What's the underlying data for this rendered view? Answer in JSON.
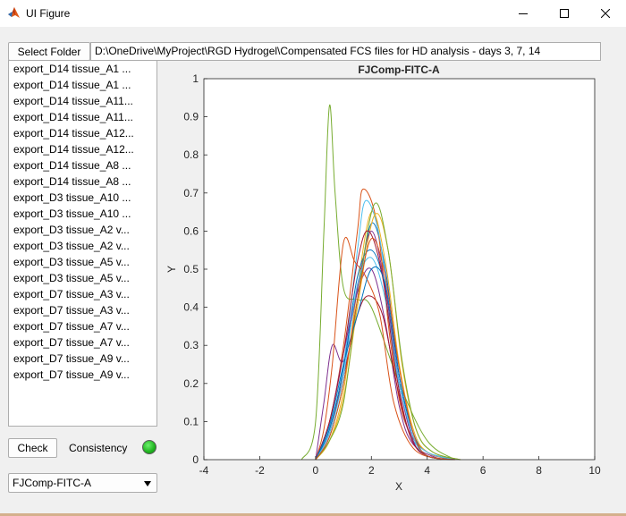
{
  "window": {
    "title": "UI Figure"
  },
  "toolbar": {
    "select_folder_label": "Select Folder",
    "folder_path": "D:\\OneDrive\\MyProject\\RGD Hydrogel\\Compensated FCS files for HD analysis - days 3, 7, 14"
  },
  "files": [
    "export_D14 tissue_A1 ...",
    "export_D14 tissue_A1 ...",
    "export_D14 tissue_A11...",
    "export_D14 tissue_A11...",
    "export_D14 tissue_A12...",
    "export_D14 tissue_A12...",
    "export_D14 tissue_A8 ...",
    "export_D14 tissue_A8 ...",
    "export_D3 tissue_A10 ...",
    "export_D3 tissue_A10 ...",
    "export_D3 tissue_A2 v...",
    "export_D3 tissue_A2 v...",
    "export_D3 tissue_A5 v...",
    "export_D3 tissue_A5 v...",
    "export_D7 tissue_A3 v...",
    "export_D7 tissue_A3 v...",
    "export_D7 tissue_A7 v...",
    "export_D7 tissue_A7 v...",
    "export_D7 tissue_A9 v...",
    "export_D7 tissue_A9 v..."
  ],
  "controls": {
    "check_label": "Check",
    "consistency_label": "Consistency",
    "status_color": "#22bb22",
    "channel_selected": "FJComp-FITC-A"
  },
  "chart_data": {
    "type": "line",
    "title": "FJComp-FITC-A",
    "xlabel": "X",
    "ylabel": "Y",
    "xlim": [
      -4,
      10
    ],
    "ylim": [
      0,
      1
    ],
    "xticks": [
      -4,
      -2,
      0,
      2,
      4,
      6,
      8,
      10
    ],
    "yticks": [
      0,
      0.1,
      0.2,
      0.3,
      0.4,
      0.5,
      0.6,
      0.7,
      0.8,
      0.9,
      1
    ],
    "ytick_labels": [
      "0",
      "0.1",
      "0.2",
      "0.3",
      "0.4",
      "0.5",
      "0.6",
      "0.7",
      "0.8",
      "0.9",
      "1"
    ],
    "grid": false,
    "series": [
      {
        "color": "#0072BD",
        "x": [
          0,
          0.5,
          1.0,
          1.5,
          2.0,
          2.5,
          3.0,
          3.5,
          4.0,
          5.0
        ],
        "y": [
          0,
          0.06,
          0.2,
          0.42,
          0.62,
          0.5,
          0.22,
          0.07,
          0.02,
          0
        ]
      },
      {
        "color": "#D95319",
        "x": [
          0,
          0.5,
          1.0,
          1.5,
          1.7,
          2.2,
          2.7,
          3.2,
          4.0,
          5.0
        ],
        "y": [
          0,
          0.1,
          0.3,
          0.6,
          0.71,
          0.62,
          0.3,
          0.1,
          0.02,
          0
        ]
      },
      {
        "color": "#EDB120",
        "x": [
          0,
          0.5,
          1.0,
          1.5,
          2.0,
          2.5,
          3.0,
          3.5,
          4.0,
          5.0
        ],
        "y": [
          0,
          0.05,
          0.18,
          0.45,
          0.65,
          0.52,
          0.25,
          0.08,
          0.02,
          0
        ]
      },
      {
        "color": "#7E2F8E",
        "x": [
          0,
          0.3,
          0.6,
          1.0,
          1.5,
          2.0,
          2.5,
          3.0,
          3.5,
          4.5
        ],
        "y": [
          0,
          0.15,
          0.3,
          0.26,
          0.44,
          0.5,
          0.36,
          0.14,
          0.04,
          0
        ]
      },
      {
        "color": "#77AC30",
        "x": [
          -0.5,
          0,
          0.3,
          0.5,
          0.7,
          1.0,
          1.5,
          2.0,
          3.0,
          4.0,
          5.0
        ],
        "y": [
          0,
          0.1,
          0.6,
          0.93,
          0.7,
          0.45,
          0.42,
          0.4,
          0.2,
          0.05,
          0
        ]
      },
      {
        "color": "#4DBEEE",
        "x": [
          0,
          0.5,
          1.0,
          1.5,
          1.8,
          2.3,
          2.8,
          3.3,
          4.0,
          5.0
        ],
        "y": [
          0,
          0.08,
          0.25,
          0.55,
          0.68,
          0.58,
          0.28,
          0.08,
          0.02,
          0
        ]
      },
      {
        "color": "#A2142F",
        "x": [
          0,
          0.5,
          1.0,
          1.5,
          1.9,
          2.4,
          2.9,
          3.4,
          4.0,
          5.0
        ],
        "y": [
          0,
          0.07,
          0.22,
          0.38,
          0.43,
          0.38,
          0.2,
          0.06,
          0.01,
          0
        ]
      },
      {
        "color": "#0072BD",
        "x": [
          0,
          0.5,
          1.0,
          1.5,
          2.0,
          2.5,
          3.0,
          3.5,
          4.0,
          5.0
        ],
        "y": [
          0,
          0.08,
          0.24,
          0.48,
          0.55,
          0.45,
          0.2,
          0.06,
          0.01,
          0
        ]
      },
      {
        "color": "#D95319",
        "x": [
          0,
          0.3,
          0.6,
          1.0,
          1.4,
          1.8,
          2.3,
          2.8,
          3.5,
          4.5
        ],
        "y": [
          0,
          0.08,
          0.25,
          0.57,
          0.52,
          0.48,
          0.38,
          0.15,
          0.03,
          0
        ]
      },
      {
        "color": "#EDB120",
        "x": [
          0,
          0.5,
          1.0,
          1.5,
          2.1,
          2.6,
          3.1,
          3.6,
          4.2,
          5.2
        ],
        "y": [
          0,
          0.05,
          0.16,
          0.4,
          0.64,
          0.55,
          0.25,
          0.08,
          0.02,
          0
        ]
      },
      {
        "color": "#7E2F8E",
        "x": [
          0,
          0.5,
          1.0,
          1.5,
          2.0,
          2.5,
          3.0,
          3.5,
          4.0,
          5.0
        ],
        "y": [
          0,
          0.1,
          0.28,
          0.45,
          0.6,
          0.45,
          0.2,
          0.05,
          0.01,
          0
        ]
      },
      {
        "color": "#77AC30",
        "x": [
          0,
          0.5,
          1.0,
          1.5,
          2.1,
          2.6,
          3.1,
          3.6,
          4.2,
          5.2
        ],
        "y": [
          0,
          0.05,
          0.15,
          0.42,
          0.67,
          0.55,
          0.26,
          0.08,
          0.02,
          0
        ]
      },
      {
        "color": "#4DBEEE",
        "x": [
          0,
          0.5,
          1.0,
          1.5,
          2.0,
          2.5,
          3.0,
          3.5,
          4.0,
          5.0
        ],
        "y": [
          0,
          0.07,
          0.22,
          0.46,
          0.53,
          0.42,
          0.2,
          0.06,
          0.01,
          0
        ]
      },
      {
        "color": "#A2142F",
        "x": [
          0,
          0.5,
          1.0,
          1.5,
          1.9,
          2.4,
          2.9,
          3.4,
          4.0,
          5.0
        ],
        "y": [
          0,
          0.1,
          0.28,
          0.52,
          0.6,
          0.48,
          0.22,
          0.06,
          0.01,
          0
        ]
      },
      {
        "color": "#0072BD",
        "x": [
          0,
          0.5,
          1.0,
          1.5,
          2.0,
          2.5,
          3.0,
          3.5,
          4.0,
          5.0
        ],
        "y": [
          0,
          0.09,
          0.25,
          0.38,
          0.5,
          0.46,
          0.22,
          0.07,
          0.01,
          0
        ]
      },
      {
        "color": "#D95319",
        "x": [
          0,
          0.5,
          1.0,
          1.5,
          2.0,
          2.5,
          3.0,
          3.5,
          4.0,
          5.0
        ],
        "y": [
          0,
          0.06,
          0.2,
          0.42,
          0.58,
          0.48,
          0.24,
          0.07,
          0.01,
          0
        ]
      }
    ]
  }
}
